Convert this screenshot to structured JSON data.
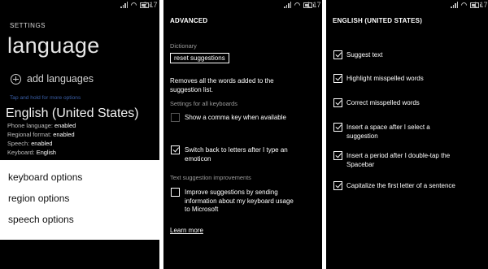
{
  "status_bars": [
    {
      "time": "2:17"
    },
    {
      "time": "1:17"
    },
    {
      "time": "1:17"
    }
  ],
  "colors": {
    "background": "#000000",
    "menu_panel": "#ffffff",
    "hint_link": "#3a5fa8",
    "disabled": "#5a5a5a"
  },
  "icons": [
    "signal-icon",
    "wifi-icon",
    "battery-icon",
    "plus-icon",
    "checkmark-icon"
  ],
  "language_screen": {
    "kicker": "SETTINGS",
    "title": "language",
    "add_languages": "add languages",
    "tap_hint": "Tap and hold for more options",
    "language_name": "English (United States)",
    "details": [
      {
        "label": "Phone language:",
        "value": "enabled"
      },
      {
        "label": "Regional format:",
        "value": "enabled"
      },
      {
        "label": "Speech:",
        "value": "enabled"
      },
      {
        "label": "Keyboard:",
        "value": "English"
      }
    ],
    "menu": [
      "keyboard options",
      "region options",
      "speech options"
    ]
  },
  "advanced_screen": {
    "header": "ADVANCED",
    "dictionary_label": "Dictionary",
    "reset_button": "reset suggestions",
    "reset_description_1": "Removes all the words added to the",
    "reset_description_2": "suggestion list.",
    "all_keyboards_label": "Settings for all keyboards",
    "comma_key": {
      "label": "Show a comma key when available",
      "checked": false,
      "disabled": true
    },
    "switch_back": {
      "label_1": "Switch back to letters after I type an",
      "label_2": "emoticon",
      "checked": true
    },
    "text_suggestion_label": "Text suggestion improvements",
    "improve": {
      "label_1": "Improve suggestions by sending",
      "label_2": "information about my keyboard usage",
      "label_3": "to Microsoft",
      "checked": false
    },
    "learn_more": "Learn more"
  },
  "english_screen": {
    "header": "ENGLISH (UNITED STATES)",
    "options": [
      {
        "label_1": "Suggest text",
        "label_2": "",
        "checked": true
      },
      {
        "label_1": "Highlight misspelled words",
        "label_2": "",
        "checked": true
      },
      {
        "label_1": "Correct misspelled words",
        "label_2": "",
        "checked": true
      },
      {
        "label_1": "Insert a space after I select a",
        "label_2": "suggestion",
        "checked": true
      },
      {
        "label_1": "Insert a period after I double-tap the",
        "label_2": "Spacebar",
        "checked": true
      },
      {
        "label_1": "Capitalize the first letter of a sentence",
        "label_2": "",
        "checked": true
      }
    ]
  }
}
